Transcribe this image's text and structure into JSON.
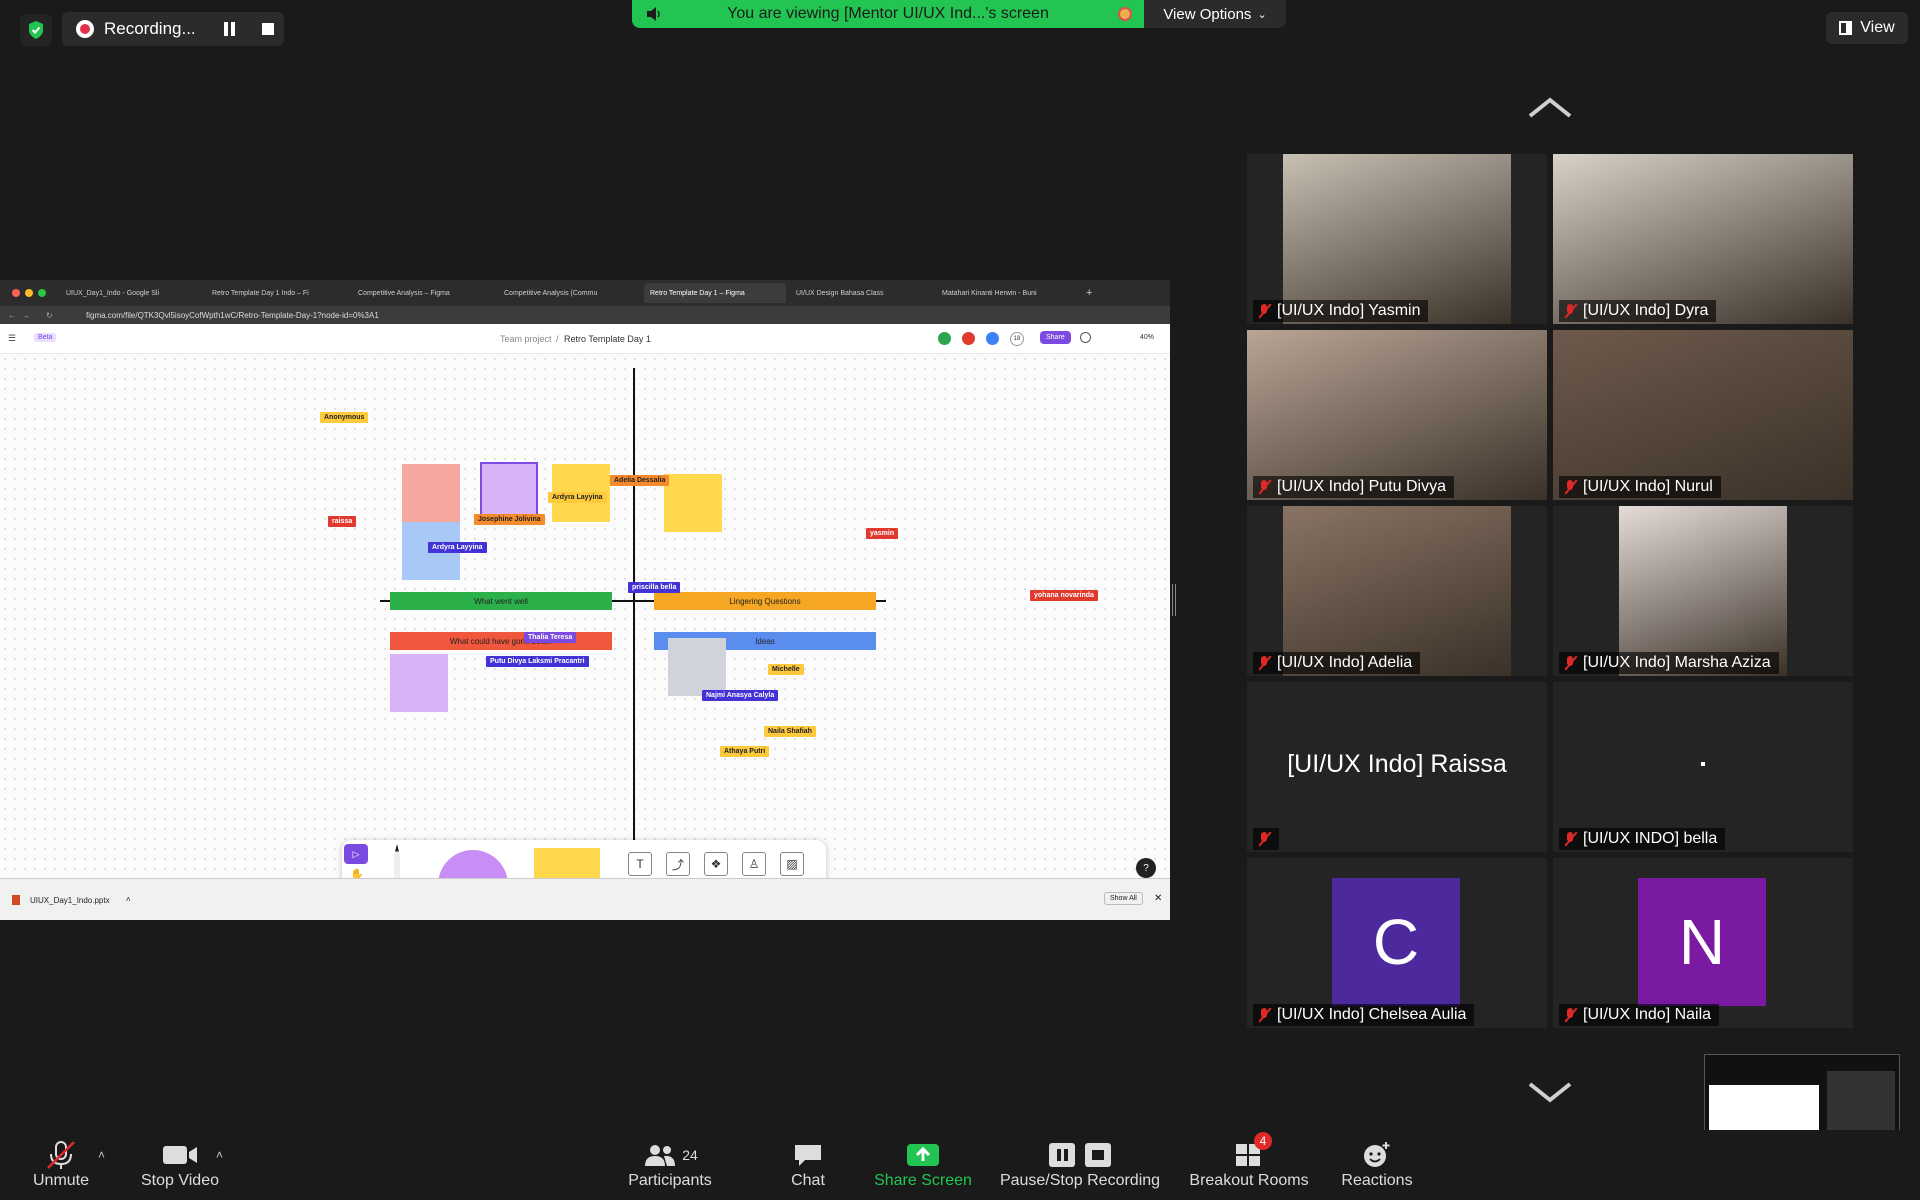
{
  "meeting": {
    "recording_label": "Recording...",
    "viewing_banner": "You are viewing [Mentor UI/UX Ind...'s screen",
    "view_options_label": "View Options",
    "view_label": "View"
  },
  "shared_screen": {
    "browser_tabs": [
      "UIUX_Day1_Indo - Google Sli",
      "Retro Template Day 1 Indo – Fi",
      "Competitive Analysis – Figma",
      "Competitive Analysis (Commu",
      "Retro Template Day 1 – Figma",
      "UI/UX Design Bahasa Class",
      "Matahari Kinanti Herwin - Buni"
    ],
    "url": "figma.com/file/QTK3Qvl5isoyCofWpth1wC/Retro-Template-Day-1?node-id=0%3A1",
    "figma": {
      "beta_badge": "Beta",
      "breadcrumb_project": "Team project",
      "breadcrumb_file": "Retro Template Day 1",
      "share_label": "Share",
      "zoom": "40%",
      "viewer_count": "18",
      "quadrants": {
        "went_well": "What went well",
        "lingering": "Lingering Questions",
        "could_better": "What could have gone better",
        "ideas": "Ideas"
      },
      "cursor_tags": [
        "Anonymous",
        "raissa",
        "Adelia Dessalia",
        "Josephine Jolivina",
        "Ardyra Layyina",
        "Ardyra Layyina",
        "priscilla bella",
        "yasmin",
        "yohana novarinda",
        "Thalia Teresa",
        "Putu Divya Laksmi Pracantri",
        "Michelle",
        "Najmi Anasya Calyla",
        "Naila Shafiah",
        "Athaya Putri"
      ],
      "help_icon": "?"
    },
    "download_file": "UIUX_Day1_Indo.pptx",
    "show_all": "Show All"
  },
  "participants": [
    {
      "name": "[UI/UX Indo] Yasmin",
      "muted": true,
      "video": true,
      "color": "#c9c0b4"
    },
    {
      "name": "[UI/UX Indo] Dyra",
      "muted": true,
      "video": true,
      "color": "#d8d2c8"
    },
    {
      "name": "[UI/UX Indo] Putu Divya",
      "muted": true,
      "video": true,
      "color": "#b9a596"
    },
    {
      "name": "[UI/UX Indo] Nurul",
      "muted": true,
      "video": true,
      "color": "#6e5a4c"
    },
    {
      "name": "[UI/UX Indo] Adelia",
      "muted": true,
      "video": true,
      "color": "#8a7464"
    },
    {
      "name": "[UI/UX Indo] Marsha Aziza",
      "muted": true,
      "video": true,
      "color": "#e6dcd8"
    },
    {
      "name": "[UI/UX Indo] Raissa",
      "muted": true,
      "video": false
    },
    {
      "name": "[UI/UX INDO] bella",
      "muted": true,
      "video": false
    },
    {
      "name": "[UI/UX Indo] Chelsea Aulia",
      "muted": true,
      "video": false,
      "initial": "C",
      "avatar_color": "#4c2a9e"
    },
    {
      "name": "[UI/UX Indo] Naila",
      "muted": true,
      "video": false,
      "initial": "N",
      "avatar_color": "#7a1aa2"
    }
  ],
  "toolbar": {
    "unmute": "Unmute",
    "stop_video": "Stop Video",
    "participants": "Participants",
    "participants_count": "24",
    "chat": "Chat",
    "share_screen": "Share Screen",
    "pause_stop_recording": "Pause/Stop Recording",
    "breakout_rooms": "Breakout Rooms",
    "breakout_badge": "4",
    "reactions": "Reactions"
  },
  "colors": {
    "banner_green": "#23c552",
    "share_green": "#23c552",
    "mute_red": "#e02828",
    "badge_red": "#e02828"
  }
}
